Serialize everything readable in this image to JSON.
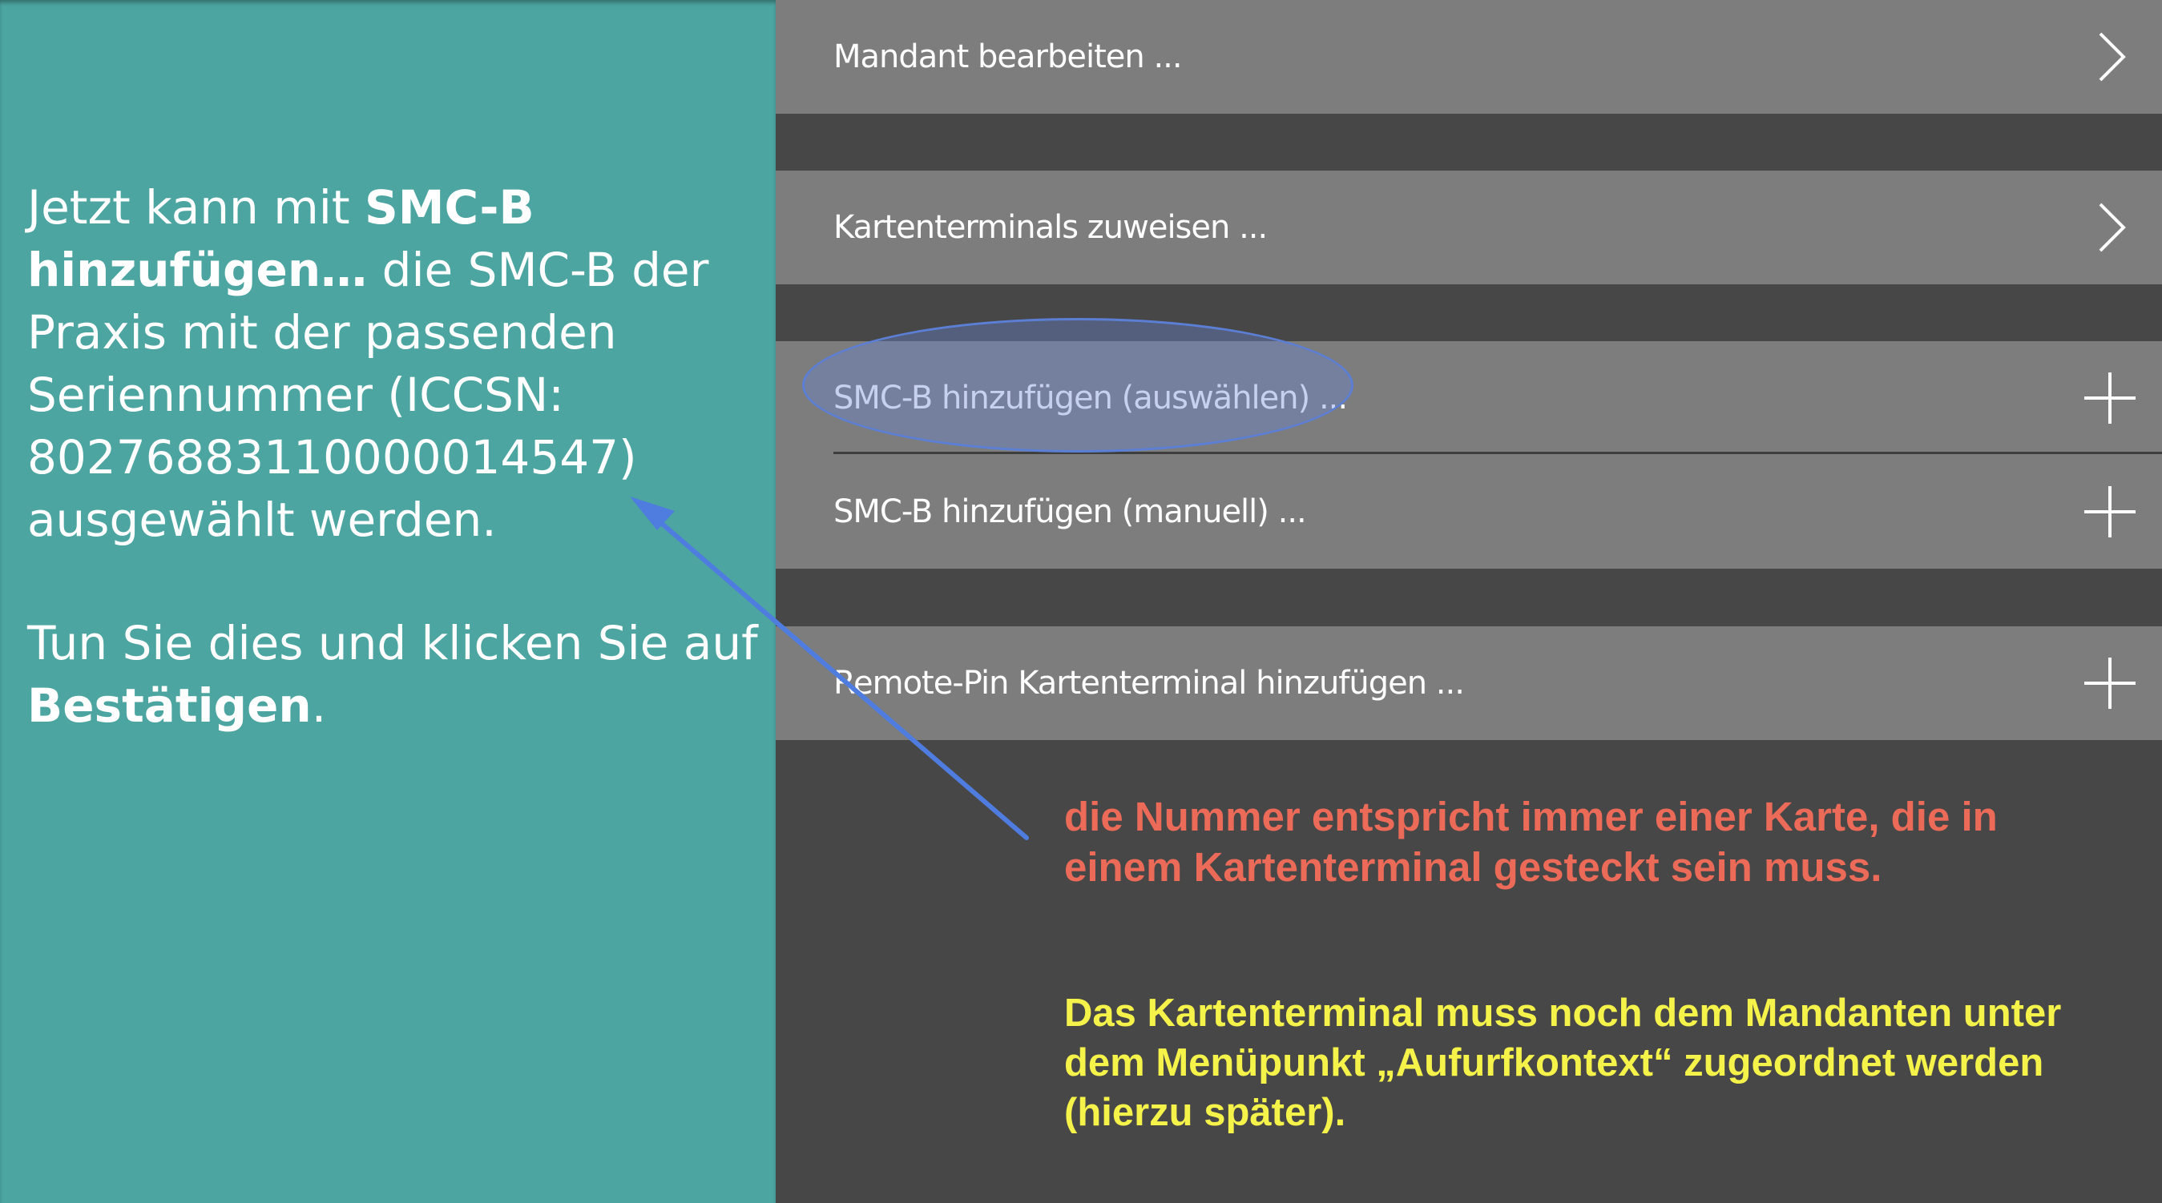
{
  "instructions": {
    "p1": {
      "t1": "Jetzt kann mit ",
      "b1": "SMC-B hinzufügen…",
      "t2": " die SMC-B der Praxis mit der passenden Seriennummer (ICCSN: 80276883110000014547) ausgewählt werden."
    },
    "p2": {
      "t1": "Tun Sie dies und klicken Sie auf ",
      "b1": "Bestätigen",
      "t2": "."
    }
  },
  "menu": {
    "items": [
      {
        "label": "Mandant bearbeiten ...",
        "icon": "chevron-right-icon"
      },
      {
        "label": "Kartenterminals zuweisen ...",
        "icon": "chevron-right-icon"
      },
      {
        "label": "SMC-B hinzufügen (auswählen) ...",
        "icon": "plus-icon"
      },
      {
        "label": "SMC-B hinzufügen (manuell) ...",
        "icon": "plus-icon"
      },
      {
        "label": "Remote-Pin Kartenterminal hinzufügen ...",
        "icon": "plus-icon"
      }
    ]
  },
  "notes": {
    "red": "die Nummer entspricht immer einer Karte, die in einem Kartenterminal gesteckt sein muss.",
    "yellow": "Das Kartenterminal muss noch dem Mandanten unter dem Menüpunkt „Aufurfkontext“ zugeordnet werden (hierzu später)."
  },
  "colors": {
    "panel_teal": "#4ca5a1",
    "menu_row": "#7d7d7d",
    "background": "#474747",
    "note_red": "#ec6a58",
    "note_yellow": "#f5f24a",
    "annotation_blue": "#4f7ddf"
  }
}
